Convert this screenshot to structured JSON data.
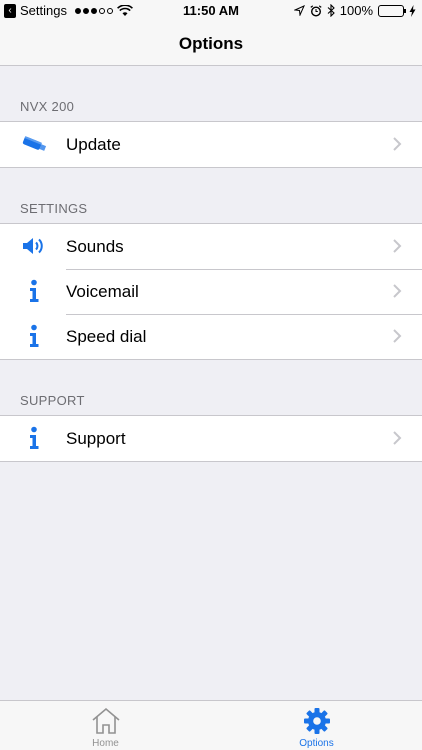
{
  "status_bar": {
    "back_label": "Settings",
    "time": "11:50 AM",
    "battery": "100%"
  },
  "nav": {
    "title": "Options"
  },
  "sections": [
    {
      "header": "NVX 200",
      "items": [
        {
          "label": "Update",
          "icon": "usb-stick-icon"
        }
      ]
    },
    {
      "header": "SETTINGS",
      "items": [
        {
          "label": "Sounds",
          "icon": "speaker-icon"
        },
        {
          "label": "Voicemail",
          "icon": "info-icon"
        },
        {
          "label": "Speed dial",
          "icon": "info-icon"
        }
      ]
    },
    {
      "header": "SUPPORT",
      "items": [
        {
          "label": "Support",
          "icon": "info-icon"
        }
      ]
    }
  ],
  "tabs": [
    {
      "label": "Home",
      "icon": "home-icon",
      "active": false
    },
    {
      "label": "Options",
      "icon": "gear-icon",
      "active": true
    }
  ],
  "colors": {
    "accent": "#1a73e8",
    "inactive": "#929292",
    "background": "#efeff4",
    "separator": "#c8c7cc",
    "battery": "#4cd964"
  }
}
